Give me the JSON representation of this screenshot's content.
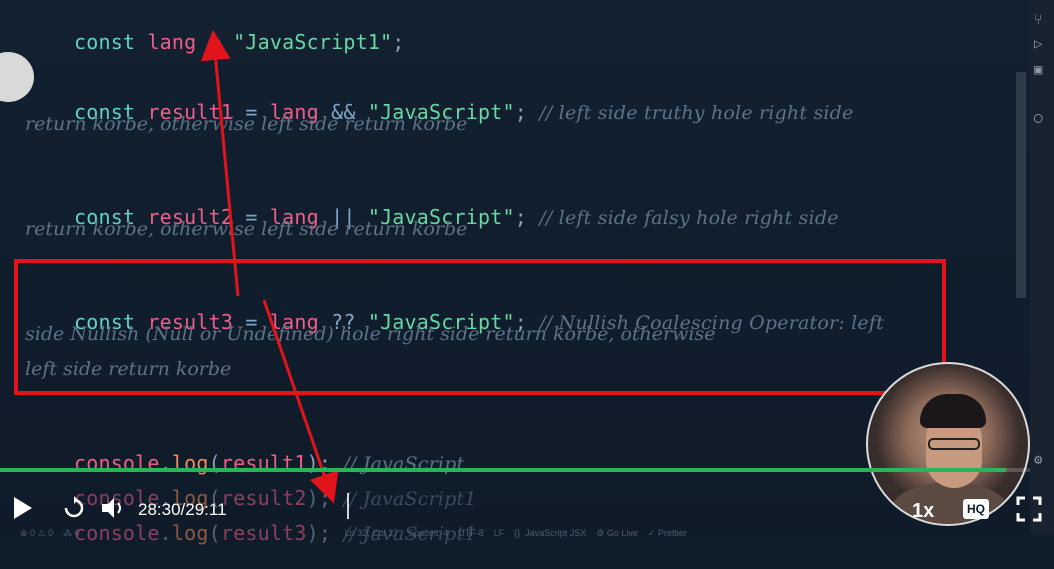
{
  "code": {
    "line1": {
      "kw": "const",
      "var": "lang",
      "op": "=",
      "str": "\"JavaScript1\"",
      "end": ";"
    },
    "line2": {
      "kw": "const",
      "var": "result1",
      "op": "=",
      "ref": "lang",
      "logic": "&&",
      "str": "\"JavaScript\"",
      "end": ";",
      "comment": "// left side truthy hole right side",
      "comment2": "return korbe, otherwise left side return korbe"
    },
    "line3": {
      "kw": "const",
      "var": "result2",
      "op": "=",
      "ref": "lang",
      "logic": "||",
      "str": "\"JavaScript\"",
      "end": ";",
      "comment": "// left side falsy hole right side",
      "comment2": "return korbe, otherwise left side return korbe"
    },
    "line4": {
      "kw": "const",
      "var": "result3",
      "op": "=",
      "ref": "lang",
      "logic": "??",
      "str": "\"JavaScript\"",
      "end": ";",
      "comment": "// Nullish Coalescing Operator: left",
      "comment2": "side Nullish (Null or Undefined) hole right side return korbe, otherwise",
      "comment3": "left side return korbe"
    },
    "log1": {
      "obj": "console",
      "fn": "log",
      "arg": "result1",
      "comment": "// JavaScript"
    },
    "log2": {
      "obj": "console",
      "fn": "log",
      "arg": "result2",
      "comment": "// JavaScript1"
    },
    "log3": {
      "obj": "console",
      "fn": "log",
      "arg": "result3",
      "comment": "// JavaScript1"
    }
  },
  "player": {
    "time": "28:30/29:11",
    "progress": 0.977,
    "speed": "1x",
    "quality": "HQ",
    "play_icon": "play-icon",
    "replay_icon": "replay-10-icon",
    "volume_icon": "volume-icon",
    "fullscreen_icon": "fullscreen-icon"
  },
  "status_bar": "⊗ 0 ⚠ 0    ⁂ 0                                                                                                          Ln 32, Col 27    Spaces: 4    UTF-8    LF    {}  JavaScript JSX    ⚙ Go Live    ✓ Prettier",
  "colors": {
    "highlight": "#e1141c",
    "progress": "#27b45a",
    "background": "#0f1c2a"
  }
}
